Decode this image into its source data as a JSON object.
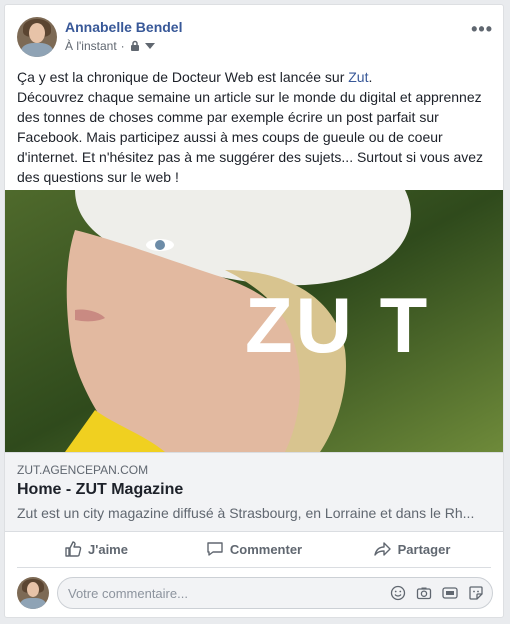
{
  "post": {
    "author": "Annabelle Bendel",
    "timestamp": "À l'instant",
    "separator": "·",
    "text_before_link": "Ça y est la chronique de Docteur Web est lancée sur ",
    "text_link": "Zut",
    "text_after_link": ".",
    "text_body": "Découvrez chaque semaine un article sur le monde du digital et apprennez des tonnes de choses comme par exemple écrire un post parfait sur Facebook. Mais participez aussi à mes coups de gueule ou de coeur d'internet. Et n'hésitez pas à me suggérer des sujets... Surtout si vous avez des questions sur le web !"
  },
  "link_preview": {
    "image_text": "ZU T",
    "domain": "ZUT.AGENCEPAN.COM",
    "title": "Home - ZUT Magazine",
    "description": "Zut est un city magazine diffusé à Strasbourg, en Lorraine et dans le Rh..."
  },
  "actions": {
    "like": "J'aime",
    "comment": "Commenter",
    "share": "Partager"
  },
  "comment": {
    "placeholder": "Votre commentaire..."
  },
  "colors": {
    "link_blue": "#385898",
    "secondary_text": "#606770",
    "card_bg": "#ffffff",
    "page_bg": "#e9ebee"
  },
  "icons": [
    "more-options-icon",
    "lock-icon",
    "caret-down-icon",
    "like-icon",
    "comment-icon",
    "share-icon",
    "emoji-icon",
    "camera-icon",
    "gif-icon",
    "sticker-icon"
  ]
}
